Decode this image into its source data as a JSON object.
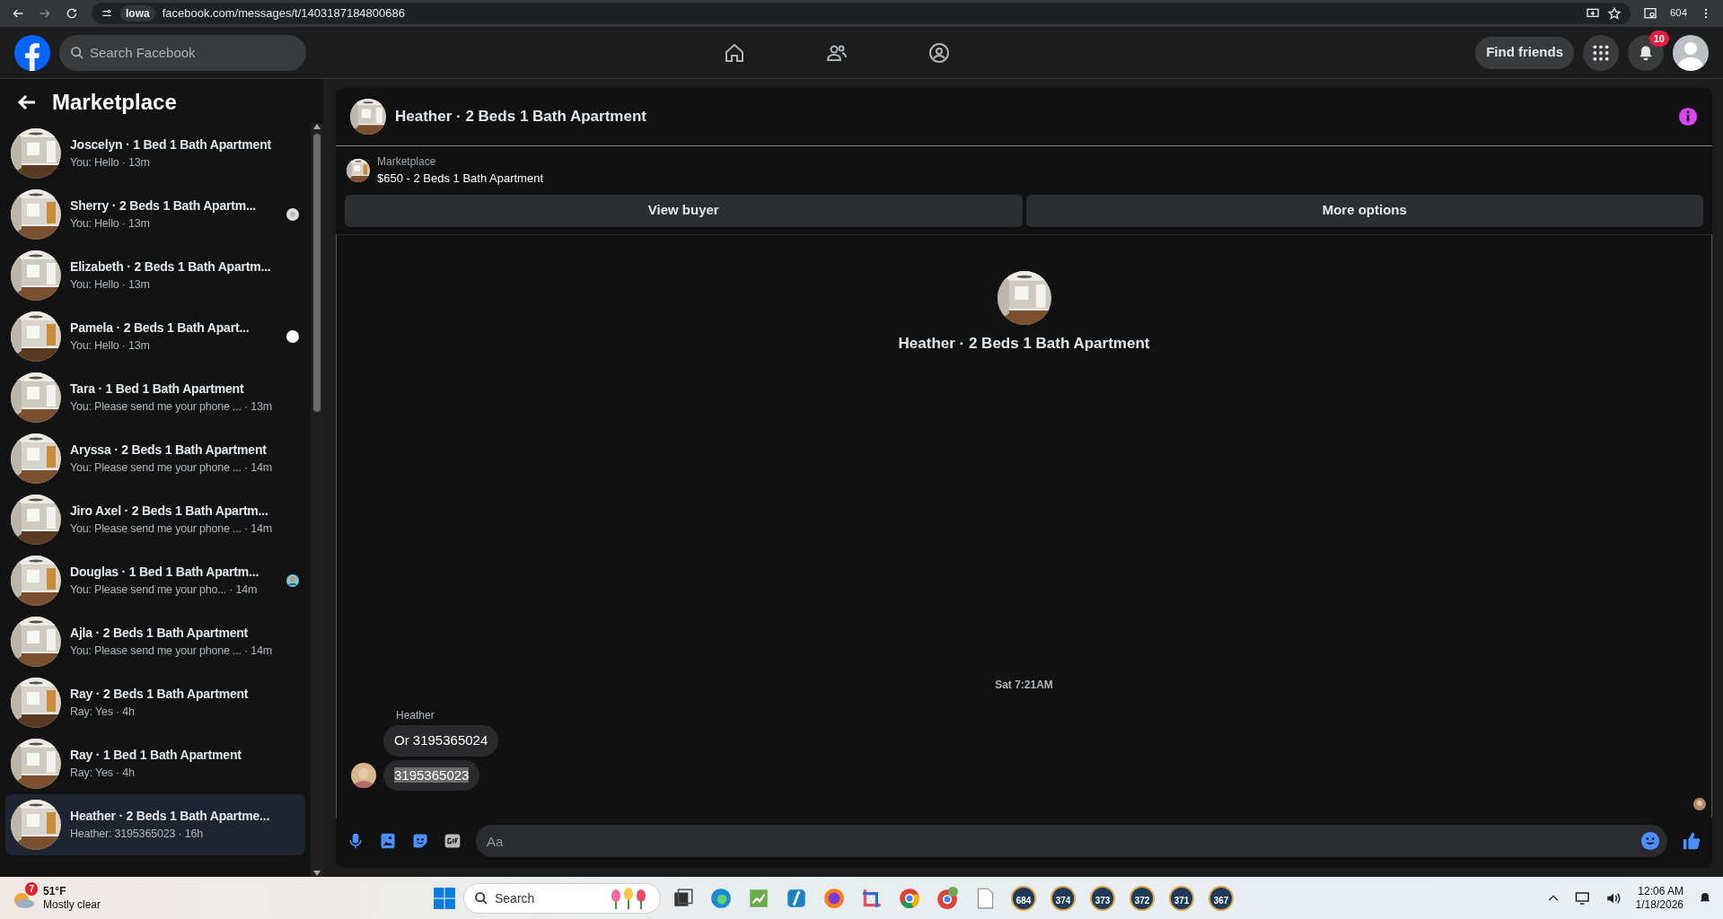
{
  "browser": {
    "site_chip": "Iowa",
    "url": "facebook.com/messages/t/1403187184800686",
    "counter": "604"
  },
  "header": {
    "search_placeholder": "Search Facebook",
    "find_friends": "Find friends",
    "notification_count": "10"
  },
  "sidebar": {
    "title": "Marketplace",
    "conversations": [
      {
        "kind": "plain",
        "title": "Joscelyn · 1 Bed 1 Bath Apartment",
        "subtitle": "You: Hello · 13m",
        "selected": false
      },
      {
        "title": "Sherry · 2 Beds 1 Bath Apartm...",
        "subtitle": "You: Hello · 13m",
        "selected": false
      },
      {
        "kind": "plain",
        "title": "Elizabeth · 2 Beds 1 Bath Apartm...",
        "subtitle": "You: Hello · 13m",
        "selected": false
      },
      {
        "kind": "dot",
        "title": "Pamela · 2 Beds 1 Bath Apart...",
        "subtitle": "You: Hello · 13m",
        "selected": false
      },
      {
        "kind": "plain",
        "title": "Tara · 1 Bed 1 Bath Apartment",
        "subtitle": "You: Please send me your phone ... · 13m",
        "selected": false
      },
      {
        "kind": "plain",
        "title": "Aryssa · 2 Beds 1 Bath Apartment",
        "subtitle": "You: Please send me your phone ... · 14m",
        "selected": false
      },
      {
        "kind": "plain",
        "title": "Jiro Axel · 2 Beds 1 Bath Apartm...",
        "subtitle": "You: Please send me your phone ... · 14m",
        "selected": false
      },
      {
        "kind": "avatar",
        "title": "Douglas · 1 Bed 1 Bath Apartm...",
        "subtitle": "You: Please send me your pho... · 14m",
        "selected": false
      },
      {
        "kind": "plain",
        "title": "Ajla · 2 Beds 1 Bath Apartment",
        "subtitle": "You: Please send me your phone ... · 14m",
        "selected": false
      },
      {
        "kind": "plain",
        "title": "Ray · 2 Beds 1 Bath Apartment",
        "subtitle": "Ray: Yes · 4h",
        "selected": false
      },
      {
        "kind": "plain",
        "title": "Ray · 1 Bed 1 Bath Apartment",
        "subtitle": "Ray: Yes · 4h",
        "selected": false
      },
      {
        "kind": "plain",
        "title": "Heather · 2 Beds 1 Bath Apartme...",
        "subtitle": "Heather: 3195365023 · 16h",
        "selected": true
      }
    ]
  },
  "chat": {
    "title": "Heather · 2 Beds 1 Bath Apartment",
    "listing": {
      "label": "Marketplace",
      "item": "$650 - 2 Beds 1 Bath Apartment"
    },
    "buttons": [
      "View buyer",
      "More options"
    ],
    "intro_title": "Heather · 2 Beds 1 Bath Apartment",
    "timestamp": "Sat 7:21AM",
    "sender": "Heather",
    "messages": [
      {
        "text": "Or 3195365024",
        "highlighted": false
      },
      {
        "text": "3195365023",
        "highlighted": true
      }
    ],
    "composer_placeholder": "Aa"
  },
  "taskbar": {
    "weather_badge": "7",
    "temperature": "51°F",
    "weather": "Mostly clear",
    "search_placeholder": "Search",
    "app_counters": [
      "684",
      "374",
      "373",
      "372",
      "371",
      "367"
    ],
    "time": "12:06 AM",
    "date": "1/18/2026"
  }
}
